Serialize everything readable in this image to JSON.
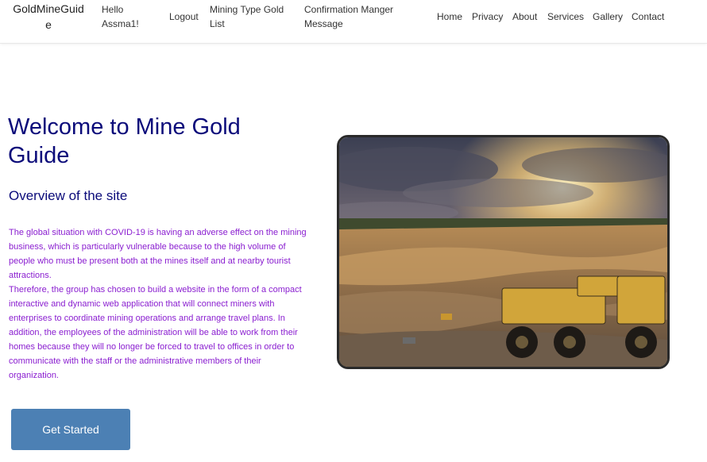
{
  "navbar": {
    "brand": "GoldMineGuide",
    "greeting": "Hello Assma1!",
    "logout": "Logout",
    "mining_type": "Mining Type Gold List",
    "confirmation": "Confirmation Manger Message",
    "links": [
      "Home",
      "Privacy",
      "About",
      "Services",
      "Gallery",
      "Contact"
    ]
  },
  "hero": {
    "title": "Welcome to Mine Gold Guide",
    "subtitle": "Overview of the site",
    "paragraph1": "The global situation with COVID-19 is having an adverse effect on the mining business, which is particularly vulnerable because to the high volume of people who must be present both at the mines itself and at nearby tourist attractions.",
    "paragraph2": "Therefore, the group has chosen to build a website in the form of a compact interactive and dynamic web application that will connect miners with enterprises to coordinate mining operations and arrange travel plans. In addition, the employees of the administration will be able to work from their homes because they will no longer be forced to travel to offices in order to communicate with the staff or the administrative members of their organization.",
    "button_label": "Get Started"
  },
  "colors": {
    "title": "#0b0b7a",
    "paragraph": "#8a1ed0",
    "button": "#4c80b4",
    "image_border": "#2a2a2a"
  }
}
